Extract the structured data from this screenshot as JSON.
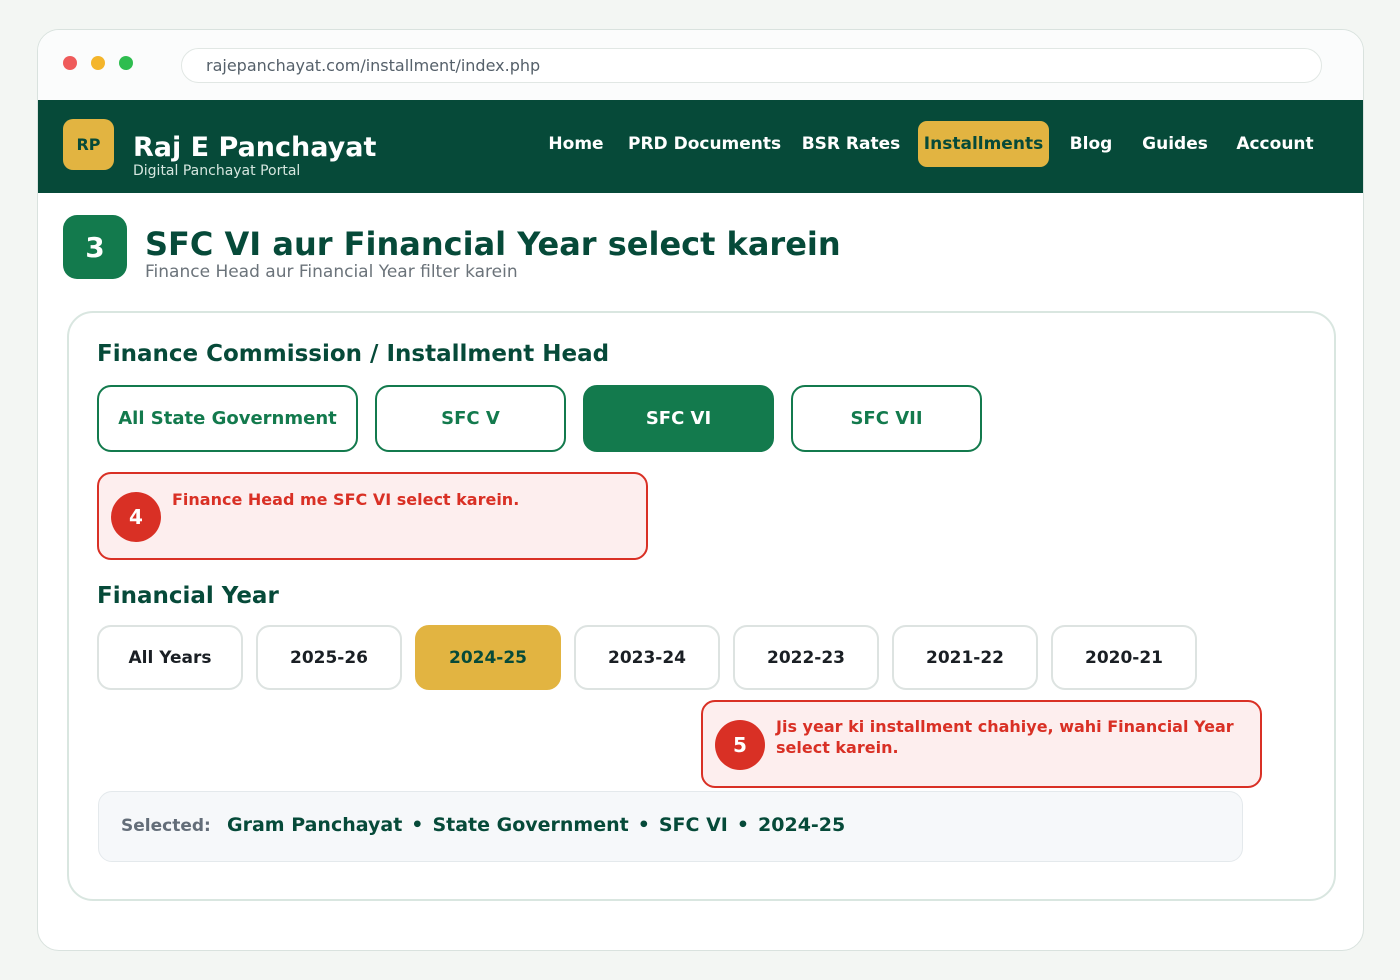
{
  "browser": {
    "url": "rajepanchayat.com/installment/index.php"
  },
  "header": {
    "logo_text": "RP",
    "brand_title": "Raj E Panchayat",
    "brand_subtitle": "Digital Panchayat Portal",
    "nav": [
      {
        "label": "Home",
        "active": false
      },
      {
        "label": "PRD Documents",
        "active": false
      },
      {
        "label": "BSR Rates",
        "active": false
      },
      {
        "label": "Installments",
        "active": true
      },
      {
        "label": "Blog",
        "active": false
      },
      {
        "label": "Guides",
        "active": false
      },
      {
        "label": "Account",
        "active": false
      }
    ]
  },
  "step": {
    "number": "3",
    "title": "SFC VI aur Financial Year select karein",
    "subtitle": "Finance Head aur Financial Year filter karein"
  },
  "finance_head": {
    "title": "Finance Commission / Installment Head",
    "options": [
      {
        "label": "All State Government",
        "selected": false
      },
      {
        "label": "SFC V",
        "selected": false
      },
      {
        "label": "SFC VI",
        "selected": true
      },
      {
        "label": "SFC VII",
        "selected": false
      }
    ]
  },
  "callouts": [
    {
      "number": "4",
      "text": "Finance Head me SFC VI select karein."
    },
    {
      "number": "5",
      "text": "Jis year ki installment chahiye, wahi Financial Year select karein."
    }
  ],
  "financial_year": {
    "title": "Financial Year",
    "options": [
      {
        "label": "All Years",
        "selected": false
      },
      {
        "label": "2025-26",
        "selected": false
      },
      {
        "label": "2024-25",
        "selected": true
      },
      {
        "label": "2023-24",
        "selected": false
      },
      {
        "label": "2022-23",
        "selected": false
      },
      {
        "label": "2021-22",
        "selected": false
      },
      {
        "label": "2020-21",
        "selected": false
      }
    ]
  },
  "summary": {
    "label": "Selected:",
    "values": [
      "Gram Panchayat",
      "State Government",
      "SFC VI",
      "2024-25"
    ],
    "separator": "•"
  },
  "colors": {
    "brand_dark": "#064a39",
    "brand_green": "#137a4d",
    "accent_gold": "#e2b441",
    "callout_red": "#d93025"
  }
}
